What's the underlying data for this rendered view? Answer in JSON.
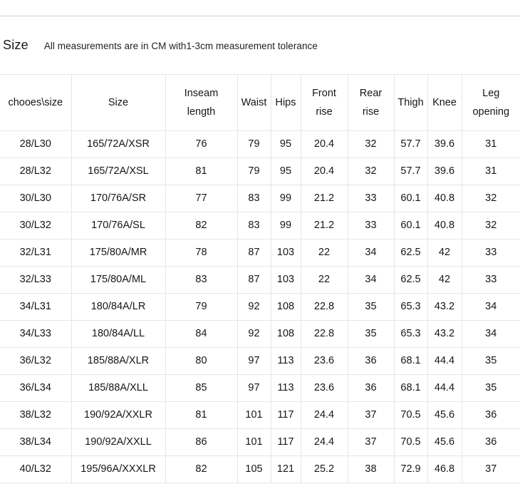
{
  "divider": {
    "color": "#cfcfcf"
  },
  "heading": {
    "title": "Size",
    "note": "All measurements are in CM with1-3cm measurement tolerance"
  },
  "table": {
    "columns": [
      "chooes\\size",
      "Size",
      "Inseam length",
      "Waist",
      "Hips",
      "Front rise",
      "Rear rise",
      "Thigh",
      "Knee",
      "Leg opening"
    ],
    "column_lines": [
      [
        "chooes\\size"
      ],
      [
        "Size"
      ],
      [
        "Inseam",
        "length"
      ],
      [
        "Waist"
      ],
      [
        "Hips"
      ],
      [
        "Front",
        "rise"
      ],
      [
        "Rear",
        "rise"
      ],
      [
        "Thigh"
      ],
      [
        "Knee"
      ],
      [
        "Leg",
        "opening"
      ]
    ],
    "rows": [
      [
        "28/L30",
        "165/72A/XSR",
        "76",
        "79",
        "95",
        "20.4",
        "32",
        "57.7",
        "39.6",
        "31"
      ],
      [
        "28/L32",
        "165/72A/XSL",
        "81",
        "79",
        "95",
        "20.4",
        "32",
        "57.7",
        "39.6",
        "31"
      ],
      [
        "30/L30",
        "170/76A/SR",
        "77",
        "83",
        "99",
        "21.2",
        "33",
        "60.1",
        "40.8",
        "32"
      ],
      [
        "30/L32",
        "170/76A/SL",
        "82",
        "83",
        "99",
        "21.2",
        "33",
        "60.1",
        "40.8",
        "32"
      ],
      [
        "32/L31",
        "175/80A/MR",
        "78",
        "87",
        "103",
        "22",
        "34",
        "62.5",
        "42",
        "33"
      ],
      [
        "32/L33",
        "175/80A/ML",
        "83",
        "87",
        "103",
        "22",
        "34",
        "62.5",
        "42",
        "33"
      ],
      [
        "34/L31",
        "180/84A/LR",
        "79",
        "92",
        "108",
        "22.8",
        "35",
        "65.3",
        "43.2",
        "34"
      ],
      [
        "34/L33",
        "180/84A/LL",
        "84",
        "92",
        "108",
        "22.8",
        "35",
        "65.3",
        "43.2",
        "34"
      ],
      [
        "36/L32",
        "185/88A/XLR",
        "80",
        "97",
        "113",
        "23.6",
        "36",
        "68.1",
        "44.4",
        "35"
      ],
      [
        "36/L34",
        "185/88A/XLL",
        "85",
        "97",
        "113",
        "23.6",
        "36",
        "68.1",
        "44.4",
        "35"
      ],
      [
        "38/L32",
        "190/92A/XXLR",
        "81",
        "101",
        "117",
        "24.4",
        "37",
        "70.5",
        "45.6",
        "36"
      ],
      [
        "38/L34",
        "190/92A/XXLL",
        "86",
        "101",
        "117",
        "24.4",
        "37",
        "70.5",
        "45.6",
        "36"
      ],
      [
        "40/L32",
        "195/96A/XXXLR",
        "82",
        "105",
        "121",
        "25.2",
        "38",
        "72.9",
        "46.8",
        "37"
      ]
    ]
  },
  "colors": {
    "border": "#e6e6e6",
    "text": "#161616",
    "background": "#ffffff"
  }
}
